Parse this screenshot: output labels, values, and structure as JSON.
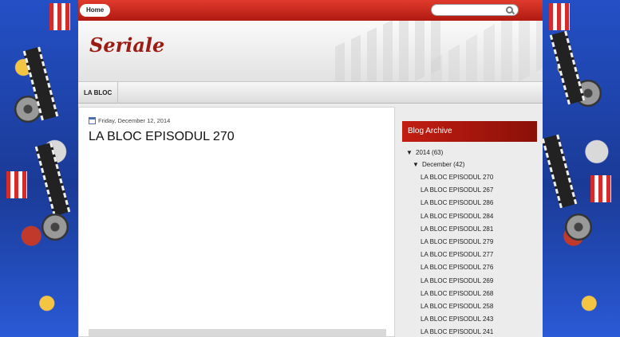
{
  "nav": {
    "home_label": "Home",
    "search_placeholder": ""
  },
  "header": {
    "site_title": "Seriale"
  },
  "tabs": [
    {
      "label": "LA BLOC"
    }
  ],
  "post": {
    "date": "Friday, December 12, 2014",
    "title": "LA BLOC EPISODUL 270"
  },
  "sidebar": {
    "archive_title": "Blog Archive",
    "year": {
      "marker": "▼",
      "label": "2014",
      "count": "(63)"
    },
    "month": {
      "marker": "▼",
      "label": "December",
      "count": "(42)"
    },
    "posts": [
      "LA BLOC EPISODUL 270",
      "LA BLOC EPISODUL 267",
      "LA BLOC EPISODUL 286",
      "LA BLOC EPISODUL 284",
      "LA BLOC EPISODUL 281",
      "LA BLOC EPISODUL 279",
      "LA BLOC EPISODUL 277",
      "LA BLOC EPISODUL 276",
      "LA BLOC EPISODUL 269",
      "LA BLOC EPISODUL 268",
      "LA BLOC EPISODUL 258",
      "LA BLOC EPISODUL 243",
      "LA BLOC EPISODUL 241"
    ]
  },
  "colors": {
    "accent": "#c21d12",
    "title": "#9b1c12",
    "background": "#1c3f9e"
  },
  "icons": {
    "search": "search-icon",
    "calendar": "calendar-icon"
  }
}
